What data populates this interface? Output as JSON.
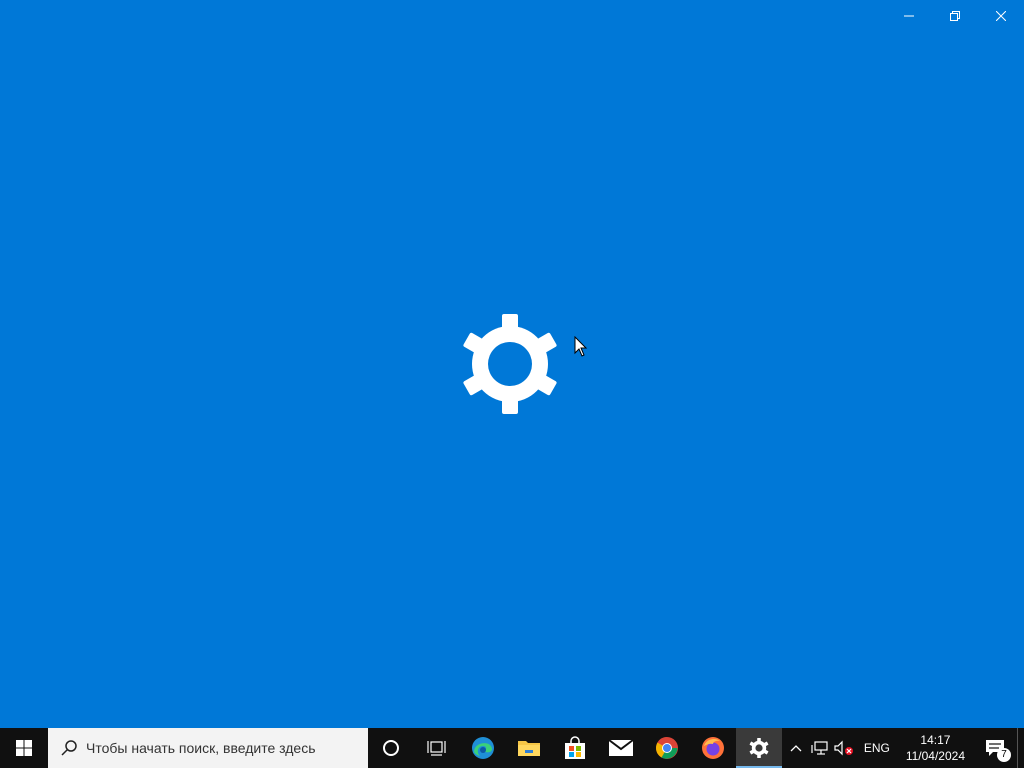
{
  "window": {
    "background": "#0078d7",
    "splash_icon": "settings-gear-icon",
    "caption_buttons": [
      "minimize-icon",
      "restore-icon",
      "close-icon"
    ]
  },
  "taskbar": {
    "start_icon": "windows-logo-icon",
    "search": {
      "icon": "search-icon",
      "placeholder": "Чтобы начать поиск, введите здесь"
    },
    "apps": [
      {
        "name": "cortana",
        "icon": "cortana-circle-icon"
      },
      {
        "name": "task-view",
        "icon": "task-view-icon"
      },
      {
        "name": "edge",
        "icon": "edge-icon"
      },
      {
        "name": "file-explorer",
        "icon": "folder-icon"
      },
      {
        "name": "store",
        "icon": "store-bag-icon"
      },
      {
        "name": "mail",
        "icon": "mail-icon"
      },
      {
        "name": "chrome",
        "icon": "chrome-icon"
      },
      {
        "name": "firefox",
        "icon": "firefox-icon"
      },
      {
        "name": "settings",
        "icon": "settings-gear-icon",
        "active": true
      }
    ],
    "tray": {
      "language": "ENG",
      "time": "14:17",
      "date": "11/04/2024",
      "notification_count": "7"
    }
  }
}
